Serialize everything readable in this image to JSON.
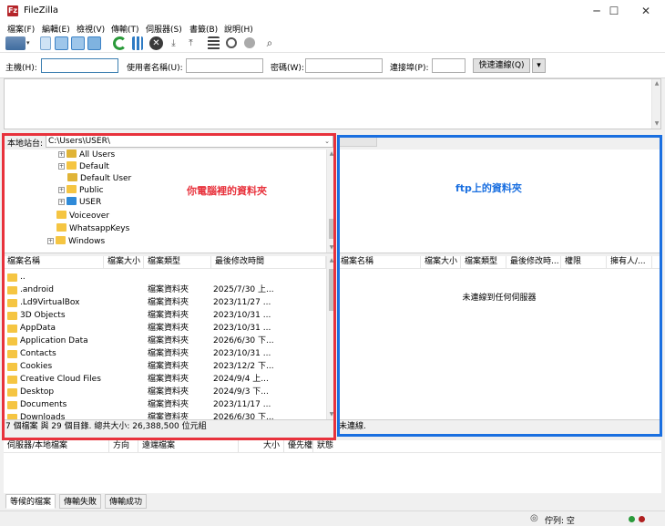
{
  "window": {
    "title": "FileZilla",
    "minimize": "─",
    "maximize": "☐",
    "close": "✕"
  },
  "menu": [
    "檔案(F)",
    "編輯(E)",
    "檢視(V)",
    "傳輸(T)",
    "伺服器(S)",
    "書籤(B)",
    "說明(H)"
  ],
  "quickconnect": {
    "host_label": "主機(H):",
    "host_value": "",
    "user_label": "使用者名稱(U):",
    "user_value": "",
    "pass_label": "密碼(W):",
    "pass_value": "",
    "port_label": "連接埠(P):",
    "port_value": "",
    "button": "快速連線(Q)",
    "dropdown_arrow": "▾"
  },
  "local": {
    "site_label": "本地站台:",
    "path": "C:\\Users\\USER\\",
    "tree": [
      {
        "label": "All Users",
        "expander": "+",
        "icon": "folder-shortcut"
      },
      {
        "label": "Default",
        "expander": "+",
        "icon": "folder"
      },
      {
        "label": "Default User",
        "expander": "",
        "icon": "folder-shortcut"
      },
      {
        "label": "Public",
        "expander": "+",
        "icon": "folder"
      },
      {
        "label": "USER",
        "expander": "+",
        "icon": "user-folder"
      },
      {
        "label": "Voiceover",
        "expander": "",
        "icon": "folder"
      },
      {
        "label": "WhatsappKeys",
        "expander": "",
        "icon": "folder"
      },
      {
        "label": "Windows",
        "expander": "+",
        "icon": "folder"
      }
    ],
    "columns": [
      "檔案名稱",
      "檔案大小",
      "檔案類型",
      "最後修改時間"
    ],
    "files": [
      {
        "name": "..",
        "size": "",
        "type": "",
        "modified": ""
      },
      {
        "name": ".android",
        "size": "",
        "type": "檔案資料夾",
        "modified": "2025/7/30 上..."
      },
      {
        "name": ".Ld9VirtualBox",
        "size": "",
        "type": "檔案資料夾",
        "modified": "2023/11/27 ..."
      },
      {
        "name": "3D Objects",
        "size": "",
        "type": "檔案資料夾",
        "modified": "2023/10/31 ..."
      },
      {
        "name": "AppData",
        "size": "",
        "type": "檔案資料夾",
        "modified": "2023/10/31 ..."
      },
      {
        "name": "Application Data",
        "size": "",
        "type": "檔案資料夾",
        "modified": "2026/6/30 下..."
      },
      {
        "name": "Contacts",
        "size": "",
        "type": "檔案資料夾",
        "modified": "2023/10/31 ..."
      },
      {
        "name": "Cookies",
        "size": "",
        "type": "檔案資料夾",
        "modified": "2023/12/2 下..."
      },
      {
        "name": "Creative Cloud Files",
        "size": "",
        "type": "檔案資料夾",
        "modified": "2024/9/4 上..."
      },
      {
        "name": "Desktop",
        "size": "",
        "type": "檔案資料夾",
        "modified": "2024/9/3 下..."
      },
      {
        "name": "Documents",
        "size": "",
        "type": "檔案資料夾",
        "modified": "2023/11/17 ..."
      },
      {
        "name": "Downloads",
        "size": "",
        "type": "檔案資料夾",
        "modified": "2026/6/30 下..."
      }
    ],
    "status": "7 個檔案 與 29 個目錄. 總共大小: 26,388,500 位元組",
    "annotation": "你電腦裡的資料夾"
  },
  "remote": {
    "columns": [
      "檔案名稱",
      "檔案大小",
      "檔案類型",
      "最後修改時...",
      "權限",
      "擁有人/..."
    ],
    "empty_message": "未連線到任何伺服器",
    "status": "未連線.",
    "annotation": "ftp上的資料夾"
  },
  "queue": {
    "columns": [
      "伺服器/本地檔案",
      "方向",
      "遠端檔案",
      "大小",
      "優先權",
      "狀態"
    ],
    "tabs": [
      "等候的檔案",
      "傳輸失敗",
      "傳輸成功"
    ]
  },
  "statusbar": {
    "queue_label": "佇列: 空"
  },
  "colors": {
    "annotation_red": "#e8323c",
    "annotation_blue": "#1a6fe0",
    "accent": "#3c7fb1"
  }
}
